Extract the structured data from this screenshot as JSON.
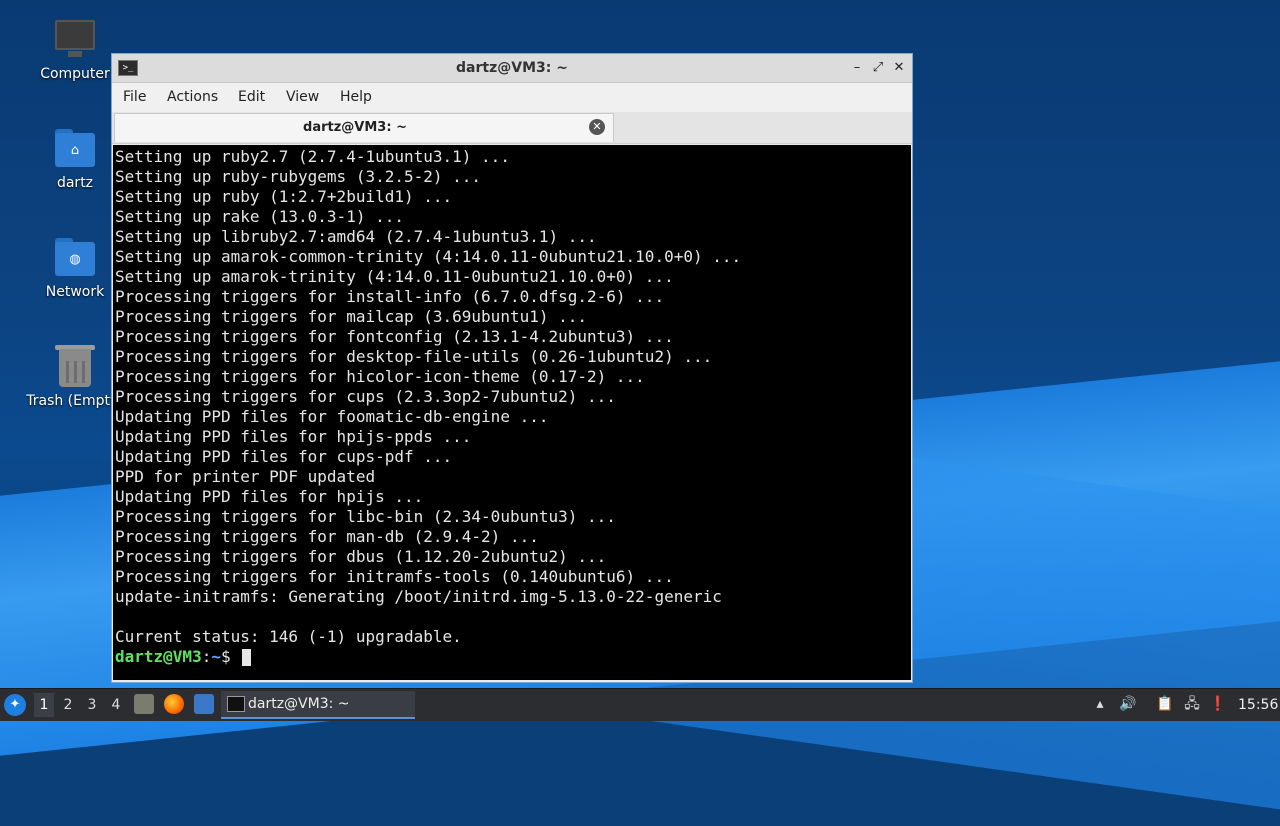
{
  "desktop": {
    "icons": [
      {
        "label": "Computer",
        "icon": "computer-icon"
      },
      {
        "label": "dartz",
        "icon": "home-folder-icon"
      },
      {
        "label": "Network",
        "icon": "network-folder-icon"
      },
      {
        "label": "Trash (Empty)",
        "icon": "trash-icon"
      }
    ]
  },
  "window": {
    "title": "dartz@VM3: ~",
    "menu": [
      "File",
      "Actions",
      "Edit",
      "View",
      "Help"
    ],
    "tab_label": "dartz@VM3: ~",
    "controls": {
      "minimize": "–",
      "maximize": "⤢",
      "close": "✕"
    }
  },
  "terminal": {
    "lines": [
      "Setting up ruby2.7 (2.7.4-1ubuntu3.1) ...",
      "Setting up ruby-rubygems (3.2.5-2) ...",
      "Setting up ruby (1:2.7+2build1) ...",
      "Setting up rake (13.0.3-1) ...",
      "Setting up libruby2.7:amd64 (2.7.4-1ubuntu3.1) ...",
      "Setting up amarok-common-trinity (4:14.0.11-0ubuntu21.10.0+0) ...",
      "Setting up amarok-trinity (4:14.0.11-0ubuntu21.10.0+0) ...",
      "Processing triggers for install-info (6.7.0.dfsg.2-6) ...",
      "Processing triggers for mailcap (3.69ubuntu1) ...",
      "Processing triggers for fontconfig (2.13.1-4.2ubuntu3) ...",
      "Processing triggers for desktop-file-utils (0.26-1ubuntu2) ...",
      "Processing triggers for hicolor-icon-theme (0.17-2) ...",
      "Processing triggers for cups (2.3.3op2-7ubuntu2) ...",
      "Updating PPD files for foomatic-db-engine ...",
      "Updating PPD files for hpijs-ppds ...",
      "Updating PPD files for cups-pdf ...",
      "PPD for printer PDF updated",
      "Updating PPD files for hpijs ...",
      "Processing triggers for libc-bin (2.34-0ubuntu3) ...",
      "Processing triggers for man-db (2.9.4-2) ...",
      "Processing triggers for dbus (1.12.20-2ubuntu2) ...",
      "Processing triggers for initramfs-tools (0.140ubuntu6) ...",
      "update-initramfs: Generating /boot/initrd.img-5.13.0-22-generic",
      "",
      "Current status: 146 (-1) upgradable."
    ],
    "prompt": {
      "user": "dartz@VM3",
      "sep": ":",
      "path": "~",
      "symbol": "$ "
    }
  },
  "taskbar": {
    "workspaces": [
      "1",
      "2",
      "3",
      "4"
    ],
    "active_workspace": "1",
    "task_label": "dartz@VM3: ~",
    "clock": "15:56",
    "colors": {
      "accent": "#5c93d6",
      "bar": "#2b2d31"
    }
  }
}
